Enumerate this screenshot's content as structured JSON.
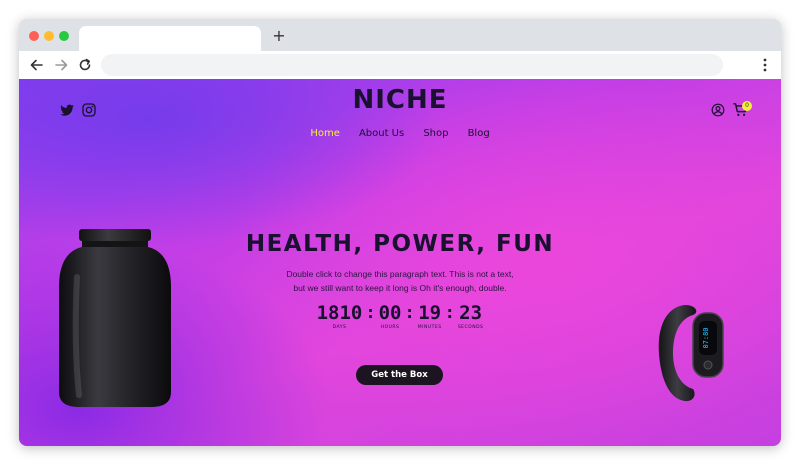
{
  "browser": {
    "tab_title": "",
    "new_tab_symbol": "+",
    "address": ""
  },
  "site": {
    "brand": "NICHE",
    "nav": [
      {
        "label": "Home",
        "active": true
      },
      {
        "label": "About Us",
        "active": false
      },
      {
        "label": "Shop",
        "active": false
      },
      {
        "label": "Blog",
        "active": false
      }
    ],
    "cart_count": "0",
    "accent_color": "#f4f03a"
  },
  "hero": {
    "title": "HEALTH, POWER, FUN",
    "text_line1": "Double click to change this paragraph text. This is not a text,",
    "text_line2": "but we still want to keep it long is Oh it's enough, double.",
    "cta_label": "Get the Box"
  },
  "countdown": {
    "days": "1810",
    "hours": "00",
    "minutes": "19",
    "seconds": "23",
    "days_label": "Days",
    "hours_label": "Hours",
    "minutes_label": "Minutes",
    "seconds_label": "Seconds",
    "separator": ":"
  },
  "fitness_band": {
    "screen_text": "07:80"
  },
  "icons": {
    "back": "arrow-left-icon",
    "forward": "arrow-right-icon",
    "reload": "reload-icon",
    "menu": "kebab-menu-icon",
    "twitter": "twitter-icon",
    "instagram": "instagram-icon",
    "user": "user-icon",
    "cart": "cart-icon"
  }
}
